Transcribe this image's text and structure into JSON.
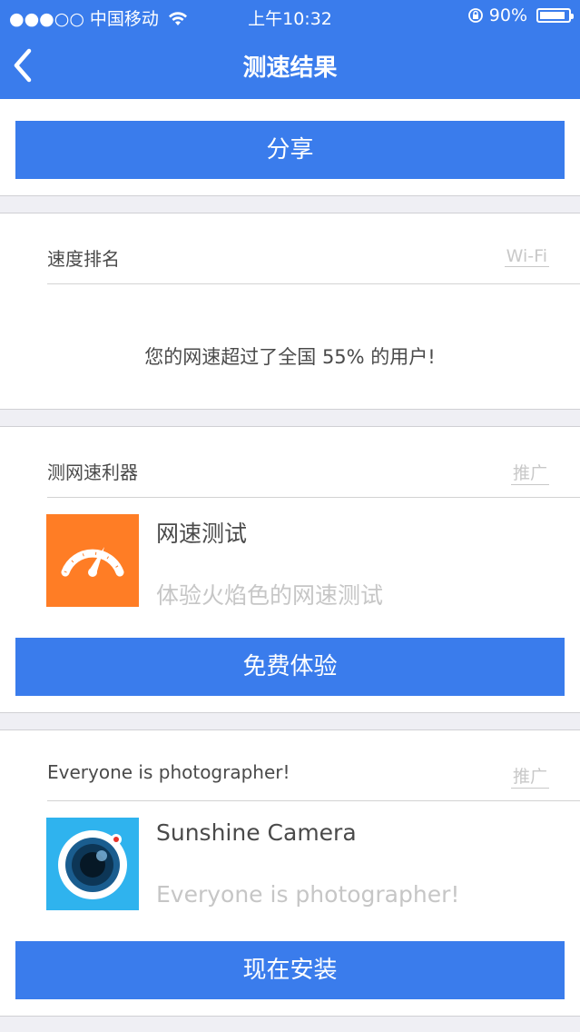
{
  "status_bar": {
    "carrier": "●●●○○ 中国移动",
    "time": "上午10:32",
    "battery": "90%",
    "battery_level": 0.9
  },
  "nav": {
    "title": "测速结果"
  },
  "share": {
    "label": "分享"
  },
  "ranking": {
    "title": "速度排名",
    "tag": "Wi-Fi",
    "message": "您的网速超过了全国 55% 的用户!"
  },
  "promos": [
    {
      "section_title": "测网速利器",
      "tag": "推广",
      "app_name": "网速测试",
      "app_desc": "体验火焰色的网速测试",
      "button": "免费体验",
      "icon": "speedometer-icon",
      "icon_color": "#ff7d25"
    },
    {
      "section_title": "Everyone is photographer!",
      "tag": "推广",
      "app_name": "Sunshine Camera",
      "app_desc": "Everyone is photographer!",
      "button": "现在安装",
      "icon": "camera-lens-icon",
      "icon_color": "#2fb3ee"
    }
  ],
  "colors": {
    "primary": "#3a7cec",
    "background": "#efeff4"
  }
}
